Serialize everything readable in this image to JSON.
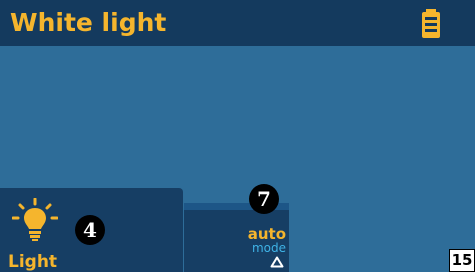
{
  "header": {
    "title": "White light",
    "battery_icon": "battery-icon"
  },
  "light_tile": {
    "label": "Light",
    "icon": "lightbulb-icon",
    "badge": "4"
  },
  "mode_tile": {
    "value": "auto",
    "caption": "mode",
    "icon": "triangle-up-icon",
    "badge": "7"
  },
  "page_number": "15",
  "colors": {
    "background": "#2e6d99",
    "header": "#143a5e",
    "tile": "#163e64",
    "accent": "#f5b52d",
    "caption": "#3fb3e6"
  }
}
